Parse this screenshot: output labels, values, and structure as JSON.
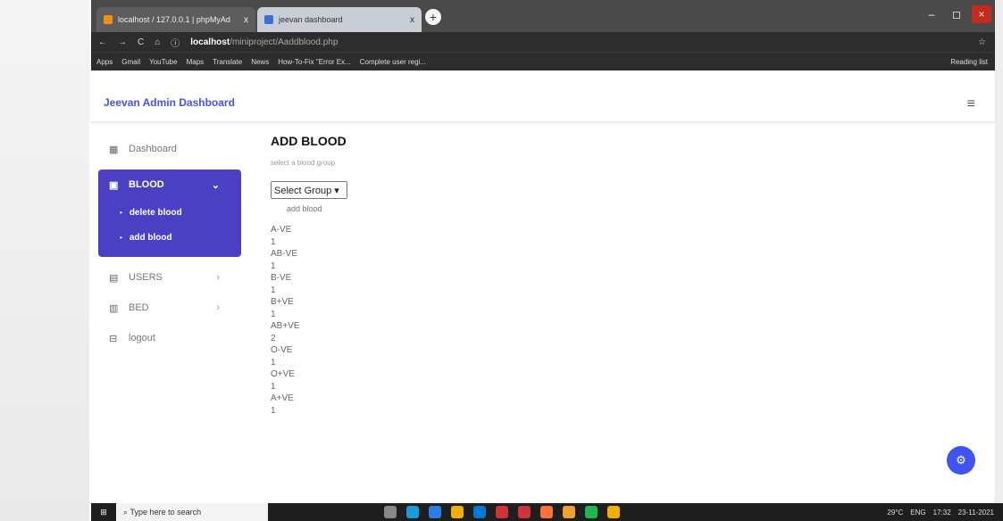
{
  "browser": {
    "tabs": [
      {
        "label": "localhost / 127.0.0.1 | phpMyAd",
        "close": "x",
        "favicon_color": "#f29111"
      },
      {
        "label": "jeevan dashboard",
        "close": "x",
        "favicon_color": "#3b6fd6"
      }
    ],
    "new_tab": "+",
    "window_controls": [
      "–",
      "◻",
      "×"
    ],
    "nav_icons": [
      "←",
      "→",
      "C",
      "⌂"
    ],
    "info_icon": "ⓘ",
    "url_host": "localhost",
    "url_path": "/miniproject/Aaddblood.php",
    "star": "☆",
    "bookmarks": [
      "Apps",
      "Gmail",
      "YouTube",
      "Maps",
      "Translate",
      "News",
      "How-To-Fix \"Error Ex...",
      "Complete user regi..."
    ],
    "reading_list": "Reading list"
  },
  "header": {
    "brand": "Jeevan Admin Dashboard",
    "menu_icon": "≡"
  },
  "sidebar": {
    "dashboard": {
      "label": "Dashboard",
      "icon": "▦"
    },
    "blood": {
      "label": "BLOOD",
      "icon": "▣",
      "chevron": "⌄"
    },
    "blood_sub": [
      "delete blood",
      "add blood"
    ],
    "users": {
      "label": "USERS",
      "icon": "▤",
      "chevron": "›"
    },
    "bed": {
      "label": "BED",
      "icon": "▥",
      "chevron": "›"
    },
    "logout": {
      "label": "logout",
      "icon": "⊟"
    }
  },
  "main": {
    "title": "ADD BLOOD",
    "hint": "select a blood group",
    "select_value": "Select Group ▾",
    "add_button": "add blood",
    "groups": [
      {
        "name": "A-VE",
        "count": "1"
      },
      {
        "name": "AB-VE",
        "count": "1"
      },
      {
        "name": "B-VE",
        "count": "1"
      },
      {
        "name": "B+VE",
        "count": "1"
      },
      {
        "name": "AB+VE",
        "count": "2"
      },
      {
        "name": "O-VE",
        "count": "1"
      },
      {
        "name": "O+VE",
        "count": "1"
      },
      {
        "name": "A+VE",
        "count": "1"
      }
    ]
  },
  "fab_icon": "⚙",
  "taskbar": {
    "start": "⊞",
    "search_placeholder": "Type here to search",
    "temperature": "29°C",
    "lang": "ENG",
    "time": "17:32",
    "date": "23-11-2021",
    "app_colors": [
      "#888888",
      "#1a9ad9",
      "#2b7de9",
      "#f0b000",
      "#0078d4",
      "#d13438",
      "#d13438",
      "#ff7139",
      "#f0a030",
      "#1db954",
      "#f0b000"
    ]
  }
}
